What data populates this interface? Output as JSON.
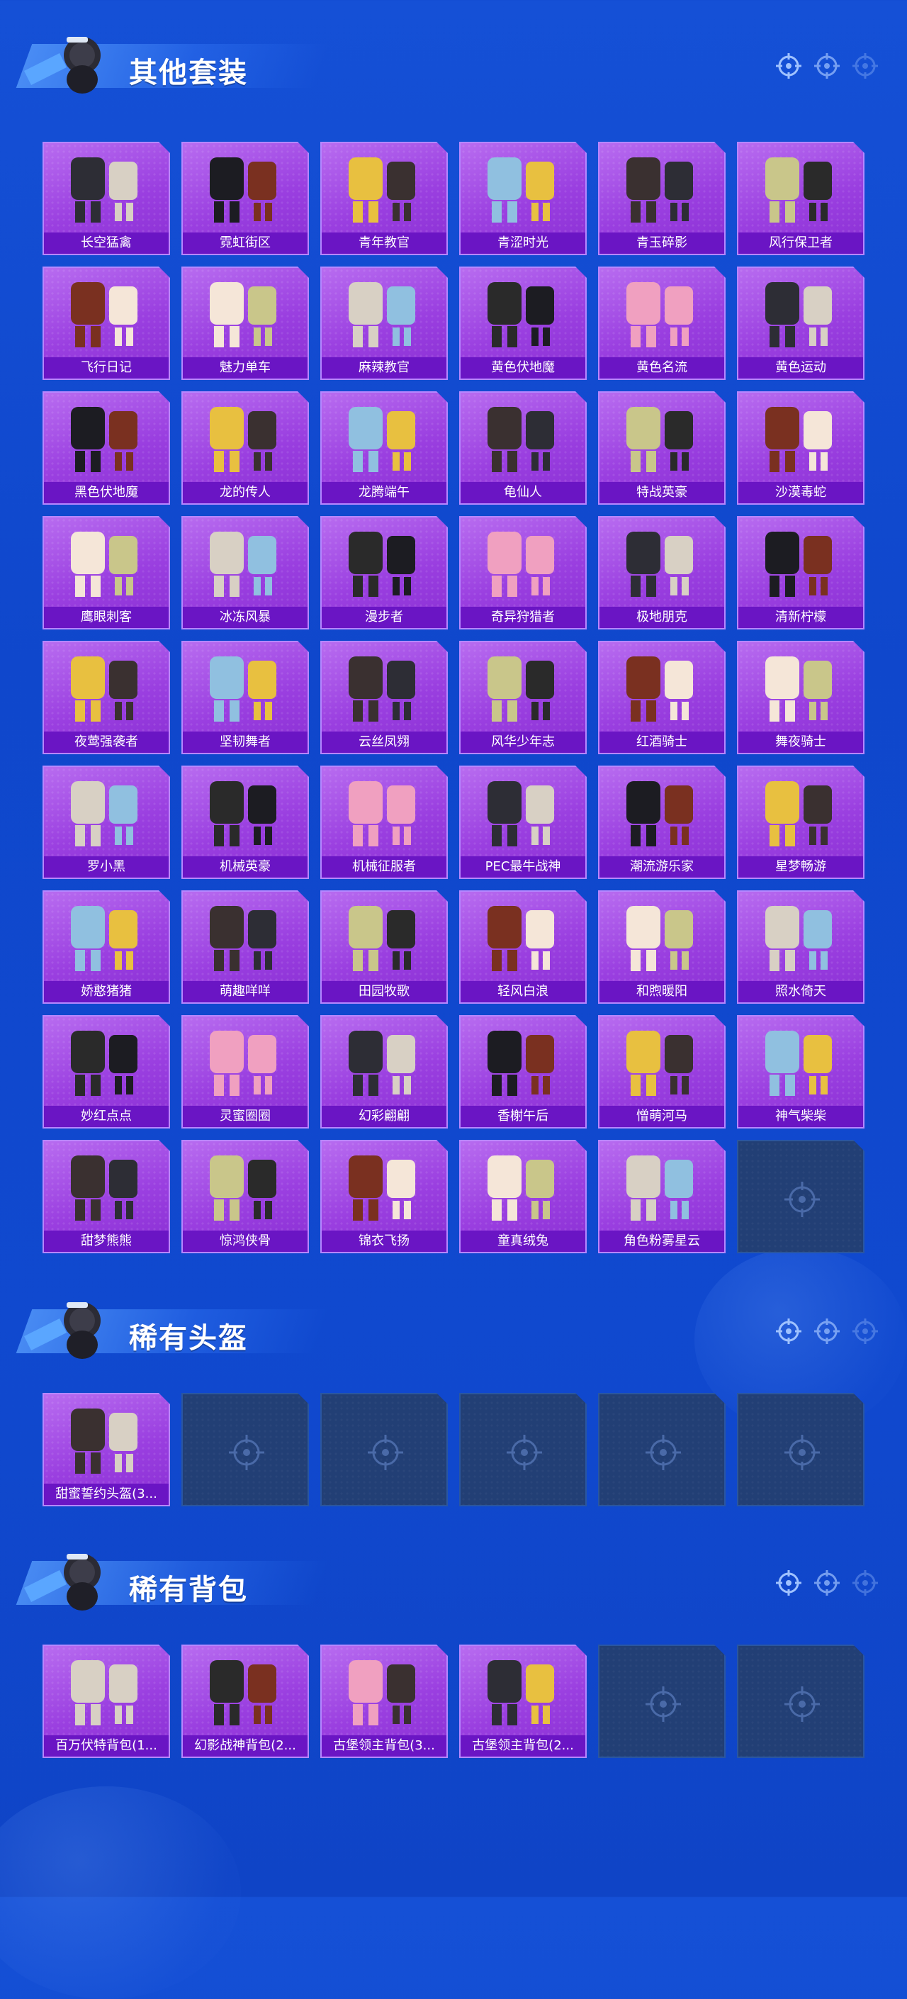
{
  "colors": {
    "background": "#1550d6",
    "card": "#9a3fe0",
    "card_label_bg": "#6a15c4",
    "empty_card": "#223f75"
  },
  "sections": [
    {
      "title": "其他套装",
      "items": [
        {
          "label": "长空猛禽"
        },
        {
          "label": "霓虹街区"
        },
        {
          "label": "青年教官"
        },
        {
          "label": "青涩时光"
        },
        {
          "label": "青玉碎影"
        },
        {
          "label": "风行保卫者"
        },
        {
          "label": "飞行日记"
        },
        {
          "label": "魅力单车"
        },
        {
          "label": "麻辣教官"
        },
        {
          "label": "黄色伏地魔"
        },
        {
          "label": "黄色名流"
        },
        {
          "label": "黄色运动"
        },
        {
          "label": "黑色伏地魔"
        },
        {
          "label": "龙的传人"
        },
        {
          "label": "龙腾端午"
        },
        {
          "label": "龟仙人"
        },
        {
          "label": "特战英豪"
        },
        {
          "label": "沙漠毒蛇"
        },
        {
          "label": "鹰眼刺客"
        },
        {
          "label": "冰冻风暴"
        },
        {
          "label": "漫步者"
        },
        {
          "label": "奇异狩猎者"
        },
        {
          "label": "极地朋克"
        },
        {
          "label": "清新柠檬"
        },
        {
          "label": "夜莺强袭者"
        },
        {
          "label": "坚韧舞者"
        },
        {
          "label": "云丝凤翙"
        },
        {
          "label": "风华少年志"
        },
        {
          "label": "红酒骑士"
        },
        {
          "label": "舞夜骑士"
        },
        {
          "label": "罗小黑"
        },
        {
          "label": "机械英豪"
        },
        {
          "label": "机械征服者"
        },
        {
          "label": "PEC最牛战神"
        },
        {
          "label": "潮流游乐家"
        },
        {
          "label": "星梦畅游"
        },
        {
          "label": "娇憨猪猪"
        },
        {
          "label": "萌趣咩咩"
        },
        {
          "label": "田园牧歌"
        },
        {
          "label": "轻风白浪"
        },
        {
          "label": "和煦暖阳"
        },
        {
          "label": "照水倚天"
        },
        {
          "label": "妙红点点"
        },
        {
          "label": "灵蜜圈圈"
        },
        {
          "label": "幻彩翩翩"
        },
        {
          "label": "香榭午后"
        },
        {
          "label": "憎萌河马"
        },
        {
          "label": "神气柴柴"
        },
        {
          "label": "甜梦熊熊"
        },
        {
          "label": "惊鸿侠骨"
        },
        {
          "label": "锦衣飞扬"
        },
        {
          "label": "童真绒兔"
        },
        {
          "label": "角色粉雾星云"
        },
        {
          "label": ""
        }
      ]
    },
    {
      "title": "稀有头盔",
      "items": [
        {
          "label": "甜蜜誓约头盔(3..."
        },
        {
          "label": ""
        },
        {
          "label": ""
        },
        {
          "label": ""
        },
        {
          "label": ""
        },
        {
          "label": ""
        }
      ]
    },
    {
      "title": "稀有背包",
      "items": [
        {
          "label": "百万伏特背包(1..."
        },
        {
          "label": "幻影战神背包(2..."
        },
        {
          "label": "古堡领主背包(3..."
        },
        {
          "label": "古堡领主背包(2..."
        },
        {
          "label": ""
        },
        {
          "label": ""
        }
      ]
    }
  ]
}
